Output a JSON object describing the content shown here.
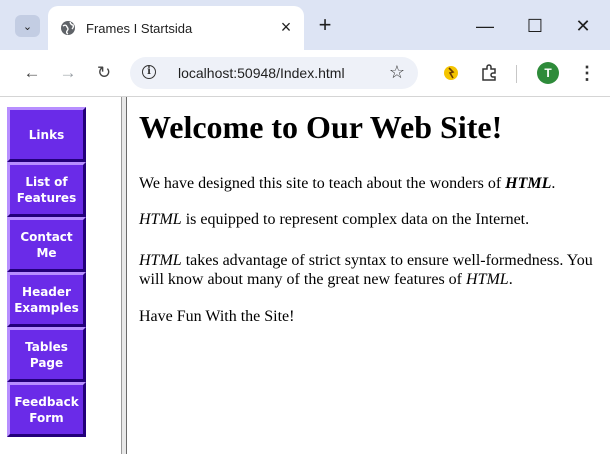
{
  "browser": {
    "tab_title": "Frames I Startsida",
    "tab_close": "×",
    "new_tab": "+",
    "tab_search": "⌄",
    "window_controls": {
      "minimize": "—",
      "maximize": "☐",
      "close": "✕"
    },
    "nav": {
      "back": "←",
      "forward": "→",
      "reload": "↻"
    },
    "url": "localhost:50948/Index.html",
    "profile_initial": "T",
    "icons": [
      "tab-search-icon",
      "globe-icon",
      "info-icon",
      "star-icon",
      "extension-icon",
      "puzzle-icon",
      "avatar",
      "menu-icon"
    ]
  },
  "sidebar": {
    "items": [
      {
        "label": "Links"
      },
      {
        "label": "List of Features"
      },
      {
        "label": "Contact Me"
      },
      {
        "label": "Header Examples"
      },
      {
        "label": "Tables Page"
      },
      {
        "label": "Feedback Form"
      }
    ],
    "button_color": "#6a2be8"
  },
  "main": {
    "heading": "Welcome to Our Web Site!",
    "p1_text": "We have designed this site to teach about the wonders of ",
    "p1_em": "HTML",
    "p1_end": ".",
    "p2_em": "HTML",
    "p2_text": " is equipped to represent complex data on the Internet.",
    "p3_em": "HTML",
    "p3_text": " takes advantage of strict syntax to ensure well-formedness. You will know about many of the great new features of ",
    "p3_em2": "HTML",
    "p3_end": ".",
    "p4_text": "Have Fun With the Site!"
  }
}
